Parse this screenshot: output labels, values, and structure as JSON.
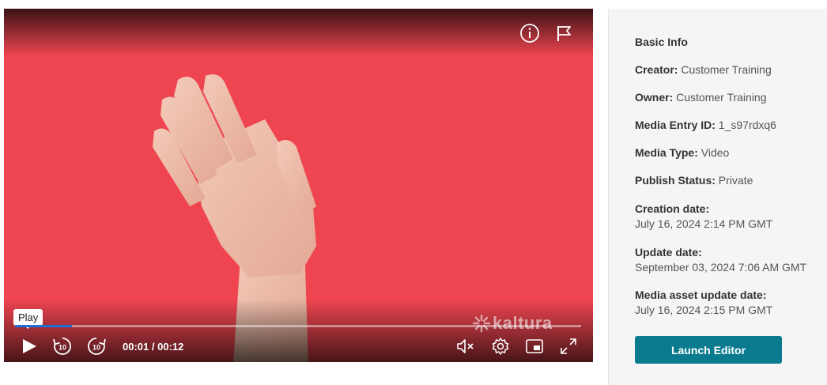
{
  "player": {
    "tooltip": "Play",
    "progress_fraction": 0.1,
    "time_current": "00:01",
    "time_separator": "/",
    "time_total": "00:12",
    "watermark": "kaltura",
    "icons": {
      "info": "info-icon",
      "flag": "flag-icon",
      "play": "play-icon",
      "rewind": "rewind-10-icon",
      "forward": "forward-10-icon",
      "mute": "volume-muted-icon",
      "settings": "gear-icon",
      "pip": "picture-in-picture-icon",
      "fullscreen": "fullscreen-icon"
    },
    "video_background": "#ef4550",
    "progress_color": "#1e6fd8"
  },
  "sidebar": {
    "title": "Basic Info",
    "creator_label": "Creator:",
    "creator_value": "Customer Training",
    "owner_label": "Owner:",
    "owner_value": "Customer Training",
    "entry_label": "Media Entry ID:",
    "entry_value": "1_s97rdxq6",
    "type_label": "Media Type:",
    "type_value": "Video",
    "status_label": "Publish Status:",
    "status_value": "Private",
    "creation_label": "Creation date:",
    "creation_value": "July 16, 2024 2:14 PM GMT",
    "update_label": "Update date:",
    "update_value": "September 03, 2024 7:06 AM GMT",
    "asset_label": "Media asset update date:",
    "asset_value": "July 16, 2024 2:15 PM GMT",
    "launch_label": "Launch Editor",
    "accent_color": "#0a7b8f"
  }
}
